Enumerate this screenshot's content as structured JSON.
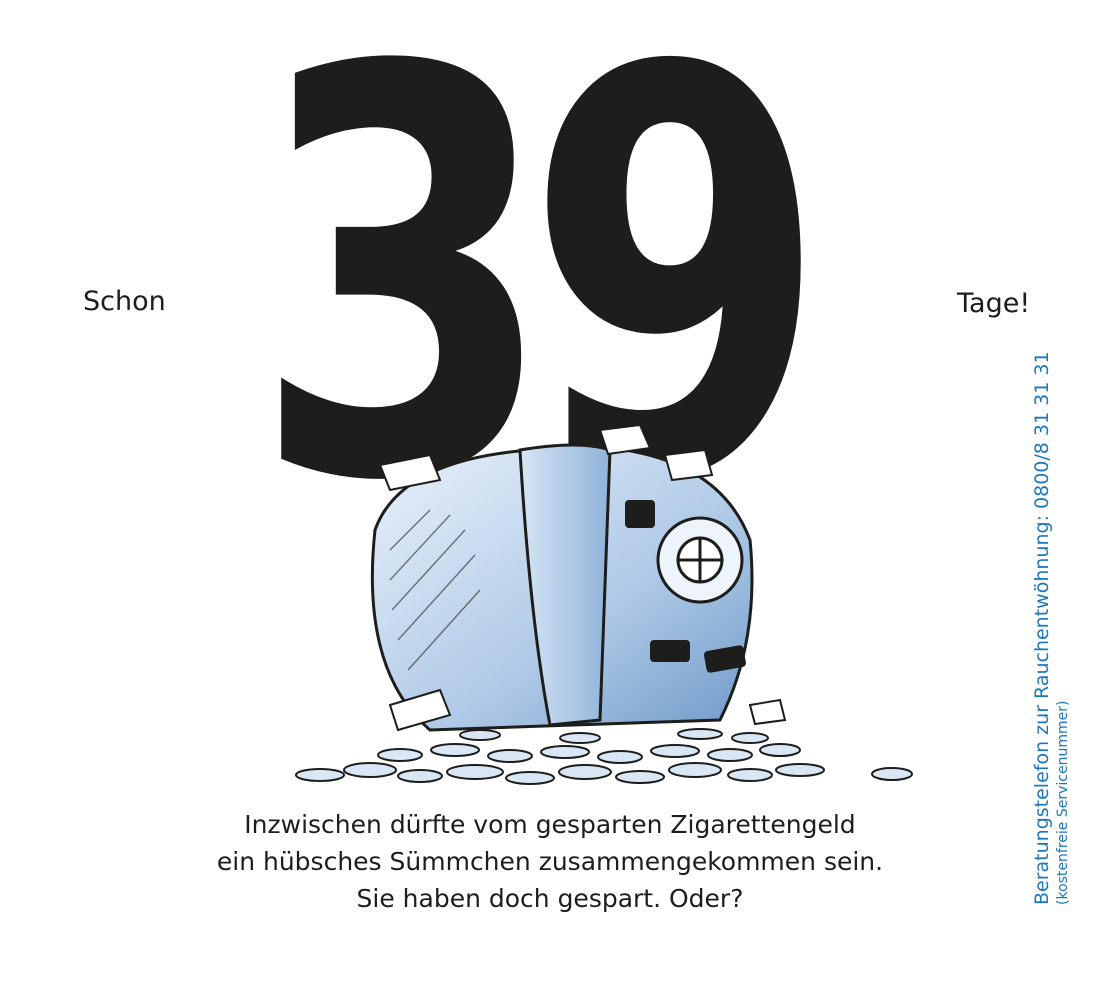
{
  "headline": {
    "prefix": "Schon",
    "number": "39",
    "suffix": "Tage!"
  },
  "message": {
    "lines": [
      "Inzwischen dürfte vom gesparten Zigarettengeld",
      "ein hübsches Sümmchen zusammengekommen sein.",
      "Sie haben doch gespart. Oder?"
    ]
  },
  "hotline": {
    "label": "Beratungstelefon zur Rauchentwöhnung: 0800/8 31 31 31",
    "note": "(kostenfreie Servicenummer)"
  },
  "colors": {
    "text": "#1d1d1b",
    "hotline": "#1a78bd",
    "illustration_blue": "#aec9e6"
  },
  "illustration": {
    "icon": "broken-safe-with-coins-icon"
  }
}
